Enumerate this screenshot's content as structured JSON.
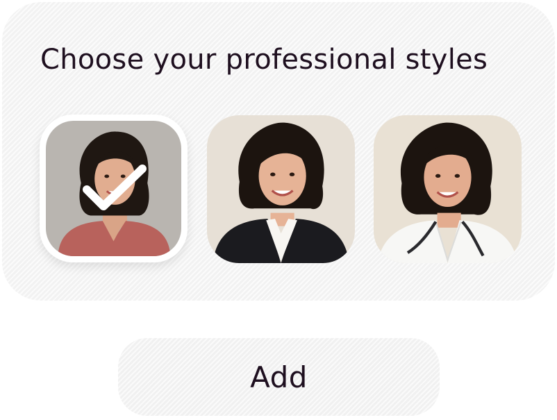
{
  "heading": "Choose your professional styles",
  "styles": [
    {
      "id": "casual",
      "selected": true
    },
    {
      "id": "business-suit",
      "selected": false
    },
    {
      "id": "doctor-coat",
      "selected": false
    }
  ],
  "icons": {
    "selected_marker": "check-icon"
  },
  "colors": {
    "text": "#1e0f1f",
    "panel": "#f6f6f6",
    "check": "#ffffff"
  },
  "actions": {
    "add_label": "Add"
  }
}
